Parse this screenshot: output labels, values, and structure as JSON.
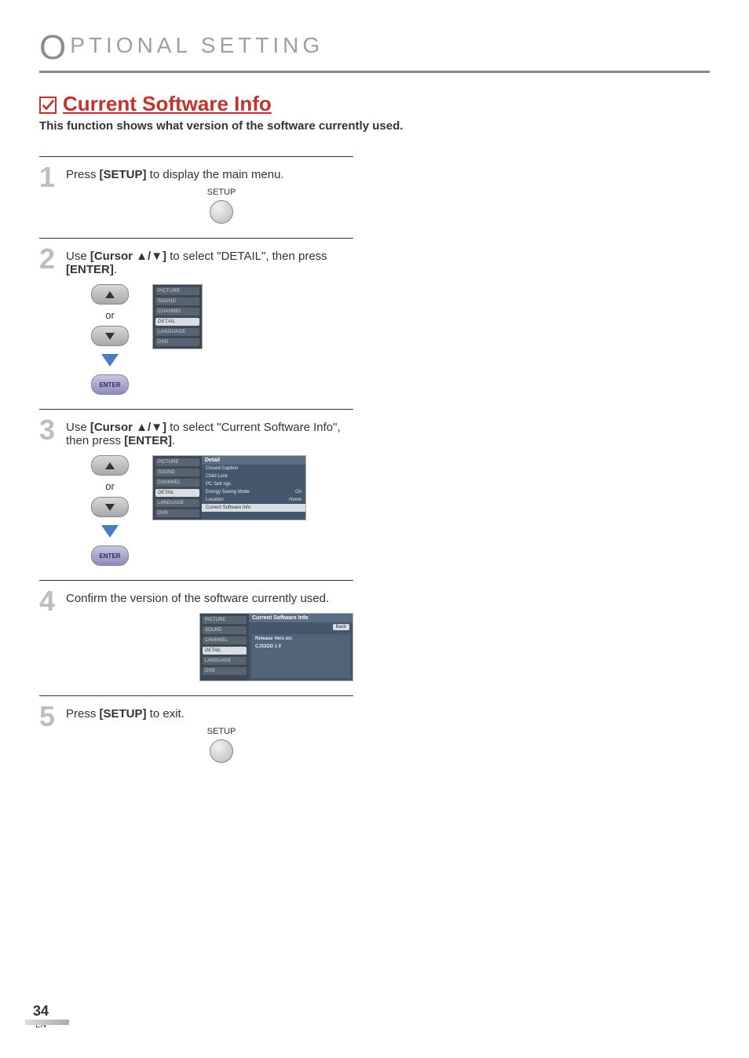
{
  "header": {
    "title": "PTIONAL  SETTING",
    "big_initial": "O"
  },
  "section": {
    "title": "Current Software Info",
    "subtitle": "This function shows what version of the software currently used."
  },
  "steps": {
    "s1": {
      "num": "1",
      "pre": "Press ",
      "bold": "[SETUP]",
      "post": " to display the main menu.",
      "btn_label": "SETUP"
    },
    "s2": {
      "num": "2",
      "pre": "Use ",
      "bold": "[Cursor ▲/▼]",
      "mid": " to select \"DETAIL\", then press ",
      "bold2": "[ENTER]",
      "post": ".",
      "or": "or",
      "enter": "ENTER",
      "menu": [
        "PICTURE",
        "SOUND",
        "CHANNEL",
        "DETAIL",
        "LANGUAGE",
        "DVD"
      ],
      "highlight_idx": 3
    },
    "s3": {
      "num": "3",
      "pre": "Use ",
      "bold": "[Cursor ▲/▼]",
      "mid": " to select \"Current Software Info\", then press ",
      "bold2": "[ENTER]",
      "post": ".",
      "or": "or",
      "enter": "ENTER",
      "side_menu": [
        "PICTURE",
        "SOUND",
        "CHANNEL",
        "DETAIL",
        "LANGUAGE",
        "DVD"
      ],
      "side_hl_idx": 3,
      "right_hdr": "Detail",
      "rows": [
        {
          "label": "Closed Caption",
          "val": ""
        },
        {
          "label": "Child Lock",
          "val": ""
        },
        {
          "label": "PC Sett ngs",
          "val": ""
        },
        {
          "label": "Energy Saving Mode",
          "val": "On"
        },
        {
          "label": "Location",
          "val": "Home"
        },
        {
          "label": "Current Software Info",
          "val": ""
        }
      ],
      "row_hl_idx": 5
    },
    "s4": {
      "num": "4",
      "text": "Confirm the version of the software currently used.",
      "side_menu": [
        "PICTURE",
        "SOUND",
        "CHANNEL",
        "DETAIL",
        "LANGUAGE",
        "DVD"
      ],
      "side_hl_idx": 3,
      "right_hdr": "Current Software Info",
      "back": "Back",
      "line1": "Release Vers on:",
      "line2": "CJ32DD  1 0"
    },
    "s5": {
      "num": "5",
      "pre": "Press ",
      "bold": "[SETUP]",
      "post": " to exit.",
      "btn_label": "SETUP"
    }
  },
  "footer": {
    "page": "34",
    "lang": "EN"
  }
}
